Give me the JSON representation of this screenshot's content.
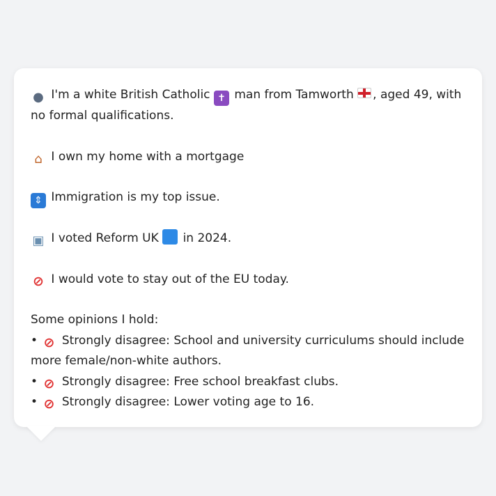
{
  "message": {
    "intro_pre": "I'm a white British Catholic",
    "intro_mid": "man from Tamworth",
    "intro_post": ", aged 49, with no formal qualifications.",
    "home": "I own my home with a mortgage",
    "issue": "Immigration is my top issue.",
    "vote_pre": "I voted Reform UK",
    "vote_post": "in 2024.",
    "eu": "I would vote to stay out of the EU today.",
    "opinions_heading": "Some opinions I hold:",
    "opinions": [
      "Strongly disagree: School and university curriculums should include more female/non-white authors.",
      "Strongly disagree: Free school breakfast clubs.",
      "Strongly disagree: Lower voting age to 16."
    ],
    "bullet": "•"
  },
  "icons": {
    "person": "bust-in-silhouette-icon",
    "cross": "latin-cross-icon",
    "flag": "england-flag-icon",
    "house": "house-icon",
    "passport": "passport-control-icon",
    "ballot": "ballot-box-icon",
    "party": "blue-square-icon",
    "no": "no-entry-sign-icon"
  },
  "colors": {
    "background": "#f2f3f5",
    "bubble": "#ffffff",
    "text": "#222222",
    "no_entry": "#e03030",
    "party_blue": "#2e8ae6"
  }
}
